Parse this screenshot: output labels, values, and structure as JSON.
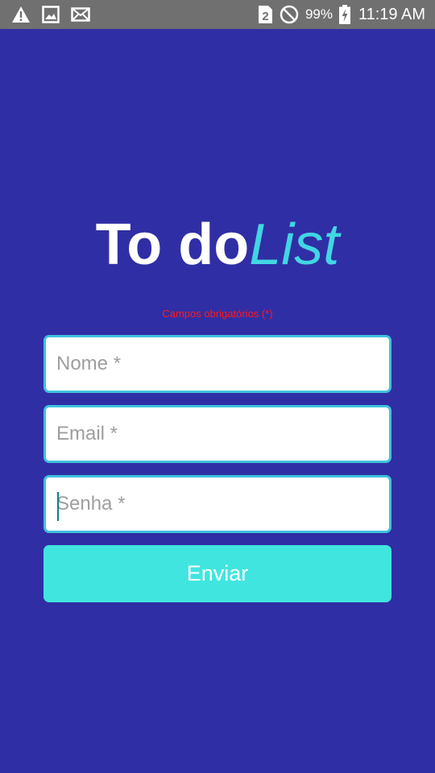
{
  "status_bar": {
    "notification_icons": [
      "warning-icon",
      "image-icon",
      "mail-icon"
    ],
    "sim_slot": "2",
    "battery_percent": "99%",
    "time": "11:19 AM"
  },
  "header": {
    "title_part1": "To do",
    "title_part2": "List"
  },
  "form": {
    "required_note": "Campos obrigatórios (*)",
    "name_placeholder": "Nome *",
    "email_placeholder": "Email *",
    "password_placeholder": "Senha *",
    "submit_label": "Enviar"
  },
  "colors": {
    "background": "#302ea5",
    "status_bar": "#707070",
    "accent": "#42d6e2",
    "field_border": "#3fc2dd",
    "button": "#41e5e0",
    "error_text": "#ff1a1a"
  }
}
